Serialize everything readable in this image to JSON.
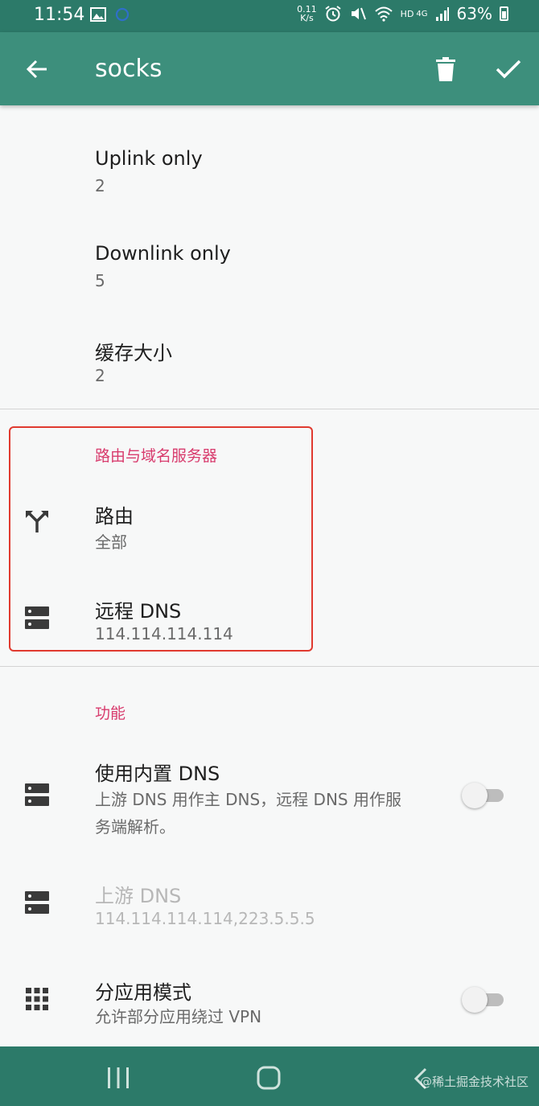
{
  "status": {
    "time": "11:54",
    "speed_top": "0.11",
    "speed_bottom": "K/s",
    "network": "HD",
    "network_gen": "4G",
    "battery": "63%"
  },
  "appbar": {
    "title": "socks",
    "icons": {
      "back": "arrow-back-icon",
      "delete": "delete-icon",
      "confirm": "check-icon"
    }
  },
  "prefs_top": [
    {
      "title": "Uplink only",
      "summary": "2"
    },
    {
      "title": "Downlink only",
      "summary": "5"
    },
    {
      "title": "缓存大小",
      "summary": "2"
    }
  ],
  "routing": {
    "category": "路由与域名服务器",
    "route": {
      "title": "路由",
      "summary": "全部",
      "icon": "fork-icon"
    },
    "remote_dns": {
      "title": "远程 DNS",
      "summary": "114.114.114.114",
      "icon": "dns-server-icon"
    }
  },
  "features": {
    "category": "功能",
    "builtin_dns": {
      "title": "使用内置 DNS",
      "summary_line1": "上游 DNS 用作主 DNS，远程 DNS 用作服",
      "summary_line2": "务端解析。",
      "checked": false
    },
    "upstream_dns": {
      "title": "上游 DNS",
      "summary": "114.114.114.114,223.5.5.5",
      "enabled": false
    },
    "per_app": {
      "title": "分应用模式",
      "summary": "允许部分应用绕过 VPN",
      "checked": false,
      "icon": "apps-grid-icon"
    }
  },
  "watermark": "@稀土掘金技术社区",
  "colors": {
    "primary": "#3d8f7c",
    "primary_dark": "#2c7a69",
    "accent": "#d83b6d",
    "highlight": "#e03a2f"
  }
}
